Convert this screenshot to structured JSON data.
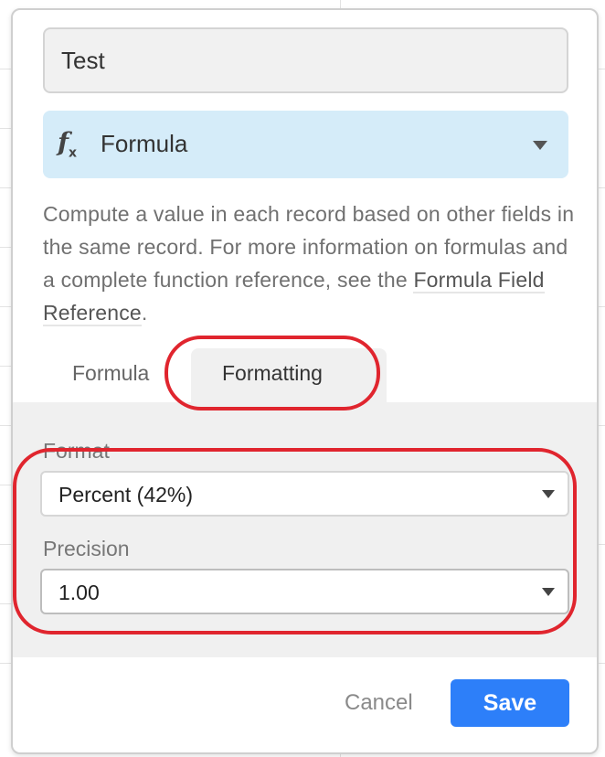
{
  "field_name": {
    "value": "Test"
  },
  "field_type": {
    "icon": "formula-fx-icon",
    "icon_text": "f",
    "icon_sub": "x",
    "label": "Formula"
  },
  "description": {
    "text": "Compute a value in each record based on other fields in the same record. For more information on formulas and a complete function reference, see the ",
    "link": "Formula Field Reference",
    "suffix": "."
  },
  "tabs": {
    "formula": "Formula",
    "formatting": "Formatting",
    "active": "formatting"
  },
  "formatting": {
    "format_label": "Format",
    "format_value": "Percent (42%)",
    "precision_label": "Precision",
    "precision_value": "1.00"
  },
  "buttons": {
    "cancel": "Cancel",
    "save": "Save"
  },
  "colors": {
    "accent": "#2d7ff9",
    "annotation": "#e0252e",
    "type_select_bg": "#d5ecf9"
  }
}
